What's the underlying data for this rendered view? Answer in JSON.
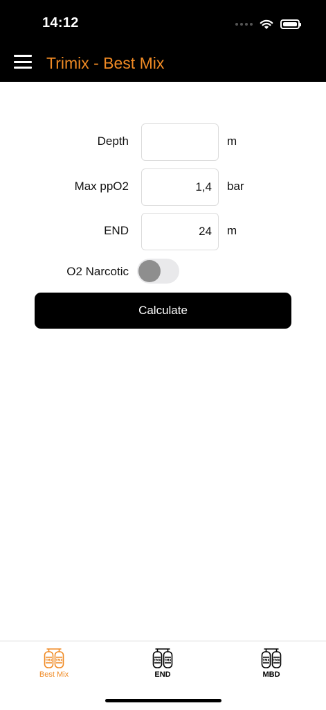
{
  "status_bar": {
    "time": "14:12"
  },
  "nav": {
    "title": "Trimix - Best Mix",
    "menu_icon": "hamburger-icon"
  },
  "form": {
    "depth": {
      "label": "Depth",
      "value": "",
      "unit": "m"
    },
    "max_ppo2": {
      "label": "Max ppO2",
      "value": "1,4",
      "unit": "bar"
    },
    "end": {
      "label": "END",
      "value": "24",
      "unit": "m"
    },
    "o2_narcotic": {
      "label": "O2 Narcotic",
      "on": false
    },
    "calculate_label": "Calculate"
  },
  "tabs": [
    {
      "label": "Best Mix",
      "icon": "twin-tanks-icon",
      "active": true
    },
    {
      "label": "END",
      "icon": "twin-tanks-icon",
      "active": false
    },
    {
      "label": "MBD",
      "icon": "twin-tanks-icon",
      "active": false
    }
  ],
  "colors": {
    "accent": "#f08a24",
    "header_bg": "#000000",
    "tab_inactive": "#000000"
  }
}
